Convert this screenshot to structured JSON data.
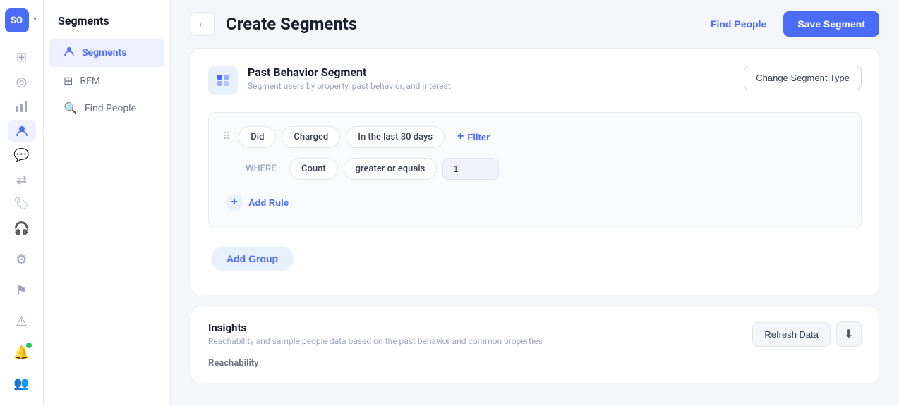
{
  "app": {
    "avatar": "SO",
    "title": "Segments"
  },
  "sidebar": {
    "items": [
      {
        "id": "segments",
        "label": "Segments",
        "icon": "👥",
        "active": true
      },
      {
        "id": "rfm",
        "label": "RFM",
        "icon": "⊞"
      },
      {
        "id": "find-people",
        "label": "Find People",
        "icon": "🔍"
      }
    ]
  },
  "nav_icons": [
    {
      "id": "dashboard",
      "icon": "⊞"
    },
    {
      "id": "activity",
      "icon": "◎"
    },
    {
      "id": "charts",
      "icon": "📊"
    },
    {
      "id": "users",
      "icon": "👤"
    },
    {
      "id": "messages",
      "icon": "💬"
    },
    {
      "id": "funnel",
      "icon": "⇄"
    },
    {
      "id": "tags",
      "icon": "🏷"
    },
    {
      "id": "support",
      "icon": "🎧"
    },
    {
      "id": "settings",
      "icon": "⚙"
    },
    {
      "id": "flag",
      "icon": "⚑"
    },
    {
      "id": "warning",
      "icon": "⚠"
    }
  ],
  "header": {
    "back_label": "←",
    "title": "Create Segments",
    "find_people_label": "Find People",
    "save_label": "Save Segment"
  },
  "segment_card": {
    "icon": "📋",
    "title": "Past Behavior Segment",
    "subtitle": "Segment users by property, past behavior, and interest",
    "change_type_label": "Change Segment Type",
    "rule_group": {
      "rule1": {
        "did_label": "Did",
        "charged_label": "Charged",
        "time_label": "In the last 30 days",
        "filter_label": "Filter"
      },
      "rule2": {
        "where_label": "WHERE",
        "count_label": "Count",
        "operator_label": "greater or equals",
        "value": "1"
      },
      "add_rule_label": "Add Rule"
    },
    "add_group_label": "Add Group"
  },
  "insights": {
    "title": "Insights",
    "subtitle": "Reachability and sample people data based on the past behavior and common properties",
    "refresh_label": "Refresh Data",
    "download_icon": "⬇",
    "reachability_label": "Reachability"
  }
}
